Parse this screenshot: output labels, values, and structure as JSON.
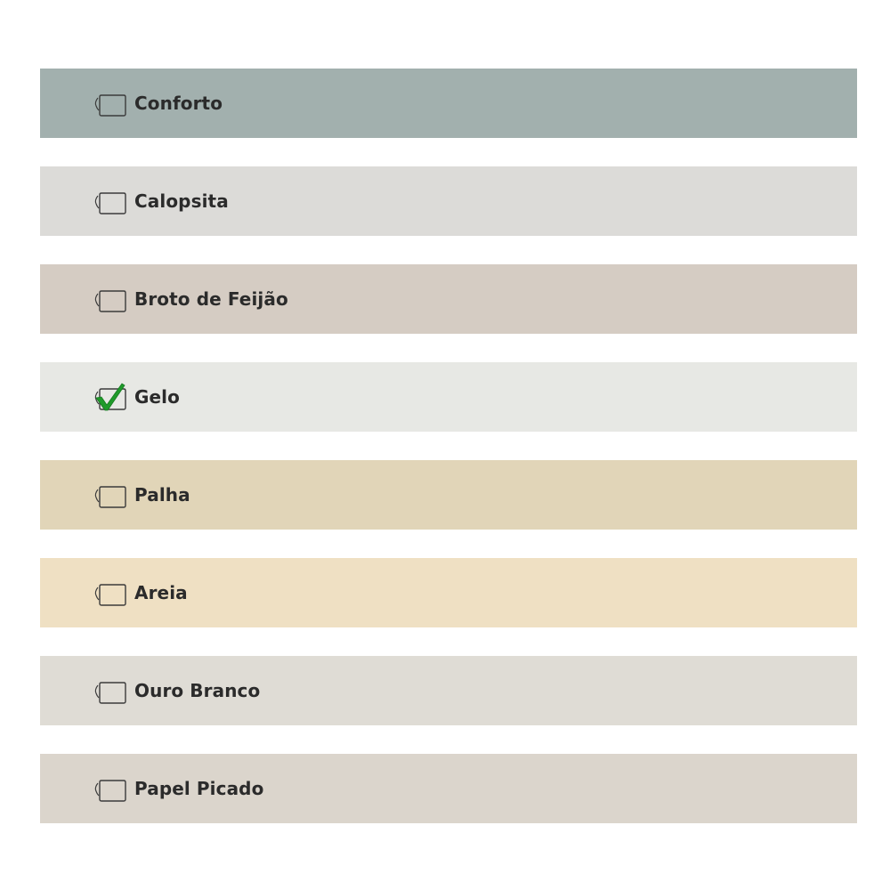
{
  "colors": [
    {
      "name": "Conforto",
      "color": "#a2b0ae",
      "checked": false
    },
    {
      "name": "Calopsita",
      "color": "#dcdbd8",
      "checked": false
    },
    {
      "name": "Broto de Feijão",
      "color": "#d5ccc3",
      "checked": false
    },
    {
      "name": "Gelo",
      "color": "#e7e8e4",
      "checked": true
    },
    {
      "name": "Palha",
      "color": "#e1d5b8",
      "checked": false
    },
    {
      "name": "Areia",
      "color": "#efe0c3",
      "checked": false
    },
    {
      "name": "Ouro Branco",
      "color": "#dfdcd5",
      "checked": false
    },
    {
      "name": "Papel Picado",
      "color": "#dbd5cc",
      "checked": false
    }
  ],
  "check_color": "#1f9a2a"
}
